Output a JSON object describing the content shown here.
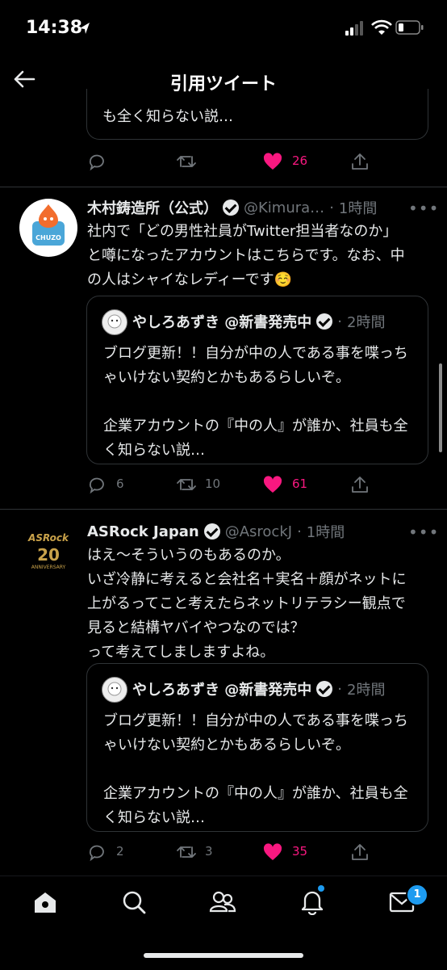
{
  "status": {
    "time": "14:38"
  },
  "header": {
    "title": "引用ツイート"
  },
  "top_partial": {
    "quote_tail": "も全く知らない説…",
    "likes": "26"
  },
  "tweets": [
    {
      "name": "木村鋳造所（公式）",
      "handle": "@Kimura…",
      "time": "1時間",
      "text": "社内で「どの男性社員がTwitter担当者なのか」と噂になったアカウントはこちらです。なお、中の人はシャイなレディーです☺️",
      "avatar_label": "CHUZO",
      "quote": {
        "name": "やしろあずき @新書発売中",
        "time": "2時間",
        "text": "ブログ更新！！自分が中の人である事を喋っちゃいけない契約とかもあるらしいぞ。\n\n企業アカウントの『中の人』が誰か、社員も全く知らない説…"
      },
      "replies": "6",
      "retweets": "10",
      "likes": "61"
    },
    {
      "name": "ASRock Japan",
      "handle": "@AsrockJ",
      "time": "1時間",
      "text": "はえ〜そういうのもあるのか。\nいざ冷静に考えると会社名＋実名＋顔がネットに上がるってこと考えたらネットリテラシー観点で見ると結構ヤバイやつなのでは？\nって考えてしましますよね。",
      "avatar_label": "ASRock",
      "avatar_sub": "ANNIVERSARY",
      "quote": {
        "name": "やしろあずき @新書発売中",
        "time": "2時間",
        "text": "ブログ更新！！自分が中の人である事を喋っちゃいけない契約とかもあるらしいぞ。\n\n企業アカウントの『中の人』が誰か、社員も全く知らない説…"
      },
      "replies": "2",
      "retweets": "3",
      "likes": "35"
    }
  ],
  "tabbar": {
    "messages_badge": "1"
  },
  "colors": {
    "like": "#f91880",
    "accent": "#1d9bf0",
    "muted": "#71767b"
  }
}
